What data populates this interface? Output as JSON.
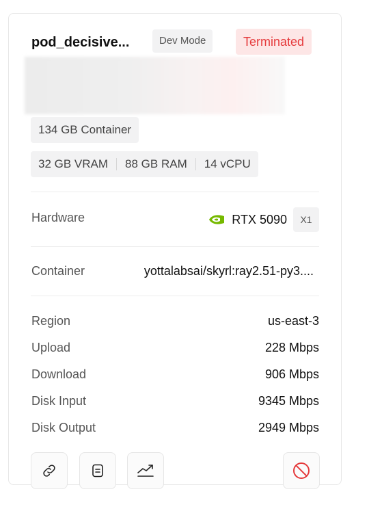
{
  "pod": {
    "name": "pod_decisive...",
    "mode_badge": "Dev Mode",
    "status": "Terminated"
  },
  "specs": {
    "container_disk": "134 GB Container",
    "vram": "32 GB VRAM",
    "ram": "88 GB RAM",
    "vcpu": "14 vCPU"
  },
  "hardware": {
    "label": "Hardware",
    "gpu_icon": "nvidia-icon",
    "gpu_name": "RTX 5090",
    "gpu_count": "X1"
  },
  "container": {
    "label": "Container",
    "value": "yottalabsai/skyrl:ray2.51-py3...."
  },
  "details": [
    {
      "label": "Region",
      "value": "us-east-3"
    },
    {
      "label": "Upload",
      "value": "228 Mbps"
    },
    {
      "label": "Download",
      "value": "906 Mbps"
    },
    {
      "label": "Disk Input",
      "value": "9345 Mbps"
    },
    {
      "label": "Disk Output",
      "value": "2949 Mbps"
    }
  ],
  "actions": [
    {
      "icon": "link-icon"
    },
    {
      "icon": "logs-icon"
    },
    {
      "icon": "chart-icon"
    },
    {
      "icon": "ban-icon"
    }
  ],
  "colors": {
    "status_text": "#e5393b",
    "status_bg": "#fde6e6",
    "nvidia_green": "#76b900",
    "danger": "#e5393b"
  }
}
